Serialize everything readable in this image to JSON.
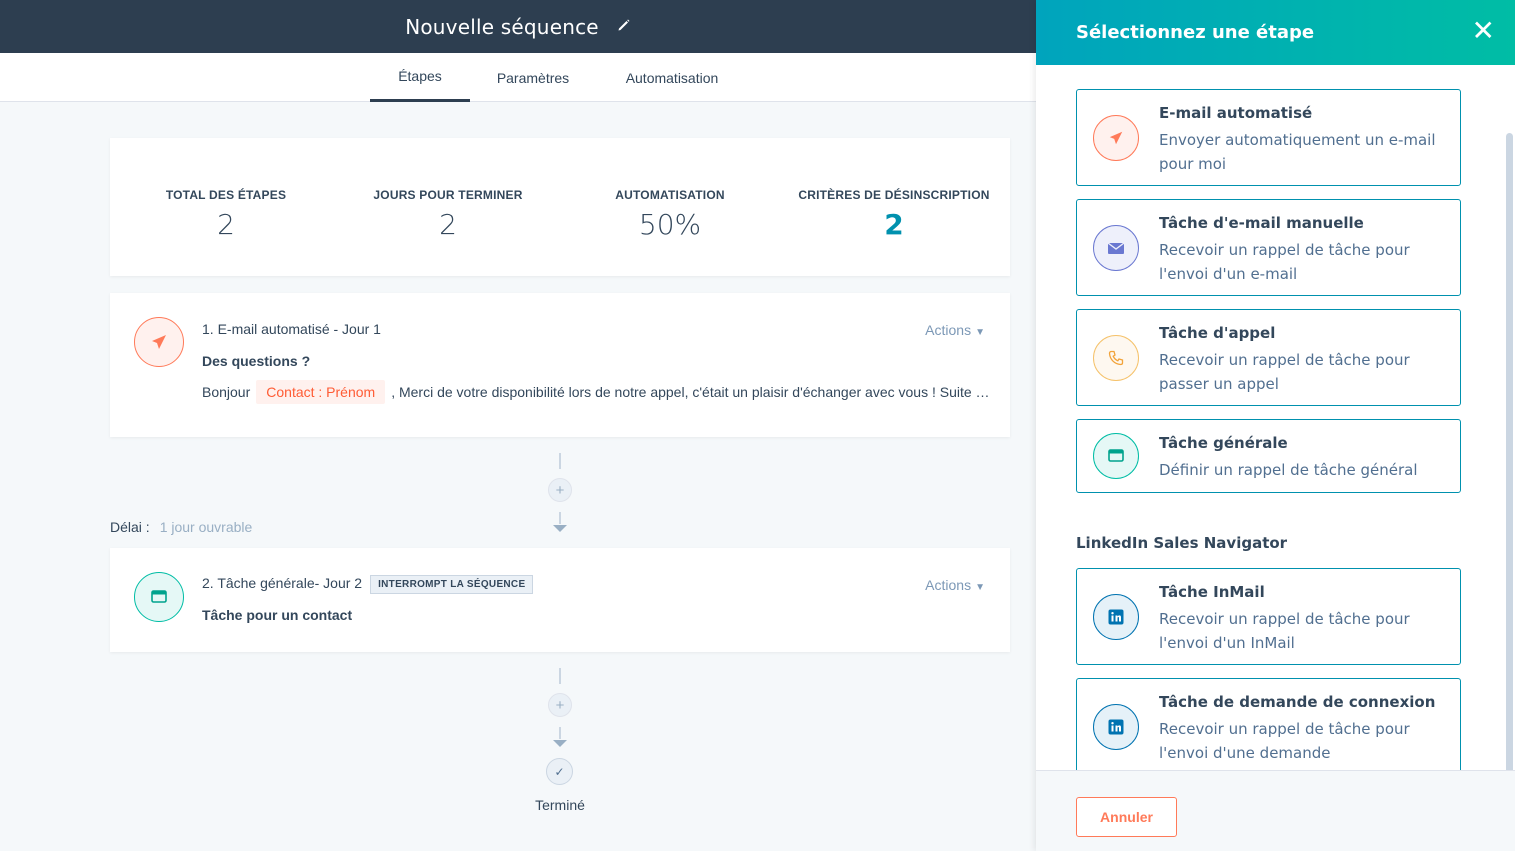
{
  "header": {
    "title": "Nouvelle séquence"
  },
  "tabs": [
    {
      "label": "Étapes"
    },
    {
      "label": "Paramètres"
    },
    {
      "label": "Automatisation"
    }
  ],
  "stats": [
    {
      "label": "TOTAL DES ÉTAPES",
      "value": "2"
    },
    {
      "label": "JOURS POUR TERMINER",
      "value": "2"
    },
    {
      "label": "AUTOMATISATION",
      "value": "50%"
    },
    {
      "label": "CRITÈRES DE DÉSINSCRIPTION",
      "value": "2"
    }
  ],
  "steps": [
    {
      "title": "1. E-mail automatisé - Jour 1",
      "actions": "Actions",
      "subject": "Des questions ?",
      "body_prefix": "Bonjour",
      "token": "Contact : Prénom",
      "body_suffix": ", Merci de votre disponibilité lors de notre appel, c'était un plaisir d'échanger avec vous ! Suite …"
    },
    {
      "title": "2. Tâche générale- Jour 2",
      "badge": "INTERROMPT LA SÉQUENCE",
      "actions": "Actions",
      "subject": "Tâche pour un contact"
    }
  ],
  "delay": {
    "label": "Délai :",
    "value": "1 jour ouvrable"
  },
  "done": {
    "label": "Terminé"
  },
  "panel": {
    "title": "Sélectionnez une étape",
    "options": [
      {
        "name": "E-mail automatisé",
        "desc": "Envoyer automatiquement un e-mail pour moi",
        "icon": "paper-plane-icon"
      },
      {
        "name": "Tâche d'e-mail manuelle",
        "desc": "Recevoir un rappel de tâche pour l'envoi d'un e-mail",
        "icon": "envelope-icon"
      },
      {
        "name": "Tâche d'appel",
        "desc": "Recevoir un rappel de tâche pour passer un appel",
        "icon": "phone-icon"
      },
      {
        "name": "Tâche générale",
        "desc": "Définir un rappel de tâche général",
        "icon": "task-icon"
      }
    ],
    "section": "LinkedIn Sales Navigator",
    "linkedin_options": [
      {
        "name": "Tâche InMail",
        "desc": "Recevoir un rappel de tâche pour l'envoi d'un InMail",
        "icon": "linkedin-icon"
      },
      {
        "name": "Tâche de demande de connexion",
        "desc": "Recevoir un rappel de tâche pour l'envoi d'une demande",
        "icon": "linkedin-icon"
      }
    ],
    "cancel": "Annuler"
  },
  "colors": {
    "header_bg": "#2d3e50",
    "accent_teal": "#0091ae",
    "accent_orange": "#ff7a59",
    "panel_gradient_start": "#00a4bd",
    "panel_gradient_end": "#00bda5"
  }
}
